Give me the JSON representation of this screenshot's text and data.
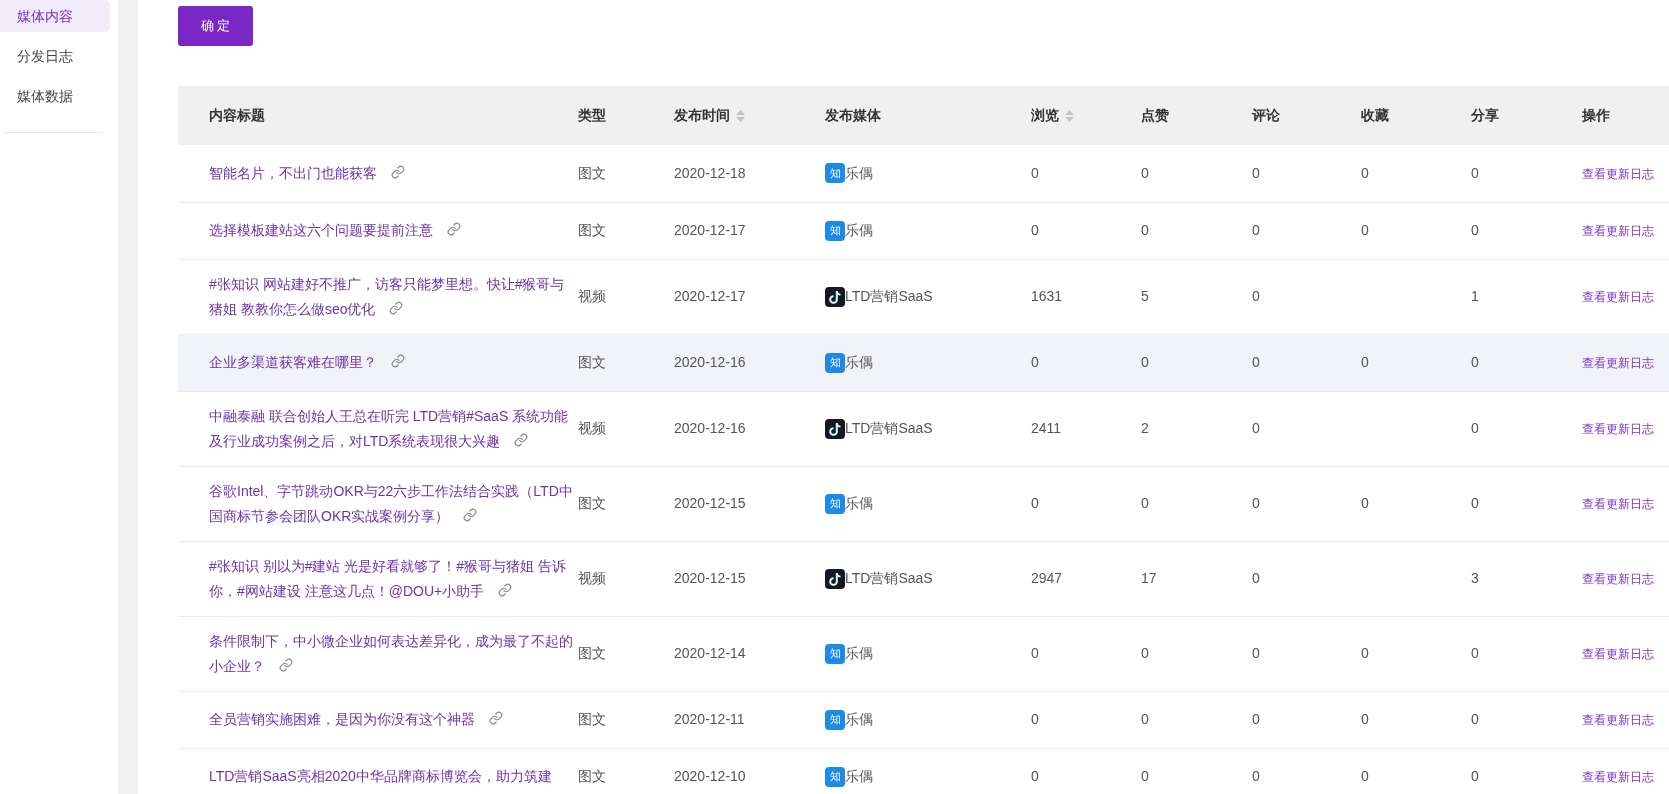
{
  "sidebar": {
    "items": [
      {
        "label": "媒体内容",
        "selected": true
      },
      {
        "label": "分发日志",
        "selected": false
      },
      {
        "label": "媒体数据",
        "selected": false
      }
    ]
  },
  "confirm_button": "确 定",
  "table": {
    "columns": [
      {
        "label": "内容标题",
        "sortable": false
      },
      {
        "label": "类型",
        "sortable": false
      },
      {
        "label": "发布时间",
        "sortable": true
      },
      {
        "label": "发布媒体",
        "sortable": false
      },
      {
        "label": "浏览",
        "sortable": true
      },
      {
        "label": "点赞",
        "sortable": false
      },
      {
        "label": "评论",
        "sortable": false
      },
      {
        "label": "收藏",
        "sortable": false
      },
      {
        "label": "分享",
        "sortable": false
      },
      {
        "label": "操作",
        "sortable": false
      }
    ],
    "rows": [
      {
        "title": "智能名片，不出门也能获客",
        "link_icon": true,
        "hovered": false,
        "type": "图文",
        "date": "2020-12-18",
        "media": {
          "kind": "zhihu",
          "badge": "知",
          "name": "乐偶"
        },
        "views": "0",
        "likes": "0",
        "comments": "0",
        "favorites": "0",
        "shares": "0",
        "action": "查看更新日志"
      },
      {
        "title": "选择模板建站这六个问题要提前注意",
        "link_icon": true,
        "hovered": false,
        "type": "图文",
        "date": "2020-12-17",
        "media": {
          "kind": "zhihu",
          "badge": "知",
          "name": "乐偶"
        },
        "views": "0",
        "likes": "0",
        "comments": "0",
        "favorites": "0",
        "shares": "0",
        "action": "查看更新日志"
      },
      {
        "title": "#张知识 网站建好不推广，访客只能梦里想。快让#猴哥与猪姐 教教你怎么做seo优化",
        "link_icon": true,
        "hovered": false,
        "type": "视频",
        "date": "2020-12-17",
        "media": {
          "kind": "douyin",
          "name": "LTD营销SaaS"
        },
        "views": "1631",
        "likes": "5",
        "comments": "0",
        "shares": "1",
        "action": "查看更新日志"
      },
      {
        "title": "企业多渠道获客难在哪里？",
        "link_icon": true,
        "hovered": true,
        "type": "图文",
        "date": "2020-12-16",
        "media": {
          "kind": "zhihu",
          "badge": "知",
          "name": "乐偶"
        },
        "views": "0",
        "likes": "0",
        "comments": "0",
        "favorites": "0",
        "shares": "0",
        "action": "查看更新日志"
      },
      {
        "title": "中融泰融 联合创始人王总在听完 LTD营销#SaaS 系统功能及行业成功案例之后，对LTD系统表现很大兴趣",
        "link_icon": true,
        "hovered": false,
        "type": "视频",
        "date": "2020-12-16",
        "media": {
          "kind": "douyin",
          "name": "LTD营销SaaS"
        },
        "views": "2411",
        "likes": "2",
        "comments": "0",
        "shares": "0",
        "action": "查看更新日志"
      },
      {
        "title": "谷歌Intel、字节跳动OKR与22六步工作法结合实践（LTD中国商标节参会团队OKR实战案例分享）",
        "link_icon": true,
        "hovered": false,
        "type": "图文",
        "date": "2020-12-15",
        "media": {
          "kind": "zhihu",
          "badge": "知",
          "name": "乐偶"
        },
        "views": "0",
        "likes": "0",
        "comments": "0",
        "favorites": "0",
        "shares": "0",
        "action": "查看更新日志"
      },
      {
        "title": "#张知识 别以为#建站 光是好看就够了！#猴哥与猪姐 告诉你，#网站建设 注意这几点！@DOU+小助手",
        "link_icon": true,
        "hovered": false,
        "type": "视频",
        "date": "2020-12-15",
        "media": {
          "kind": "douyin",
          "name": "LTD营销SaaS"
        },
        "views": "2947",
        "likes": "17",
        "comments": "0",
        "shares": "3",
        "action": "查看更新日志"
      },
      {
        "title": "条件限制下，中小微企业如何表达差异化，成为最了不起的小企业？",
        "link_icon": true,
        "hovered": false,
        "type": "图文",
        "date": "2020-12-14",
        "media": {
          "kind": "zhihu",
          "badge": "知",
          "name": "乐偶"
        },
        "views": "0",
        "likes": "0",
        "comments": "0",
        "favorites": "0",
        "shares": "0",
        "action": "查看更新日志"
      },
      {
        "title": "全员营销实施困难，是因为你没有这个神器",
        "link_icon": true,
        "hovered": false,
        "type": "图文",
        "date": "2020-12-11",
        "media": {
          "kind": "zhihu",
          "badge": "知",
          "name": "乐偶"
        },
        "views": "0",
        "likes": "0",
        "comments": "0",
        "favorites": "0",
        "shares": "0",
        "action": "查看更新日志"
      },
      {
        "title": "LTD营销SaaS亮相2020中华品牌商标博览会，助力筑建",
        "link_icon": false,
        "hovered": false,
        "type": "图文",
        "date": "2020-12-10",
        "media": {
          "kind": "zhihu",
          "badge": "知",
          "name": "乐偶"
        },
        "views": "0",
        "likes": "0",
        "comments": "0",
        "favorites": "0",
        "shares": "0",
        "action": "查看更新日志"
      }
    ]
  }
}
